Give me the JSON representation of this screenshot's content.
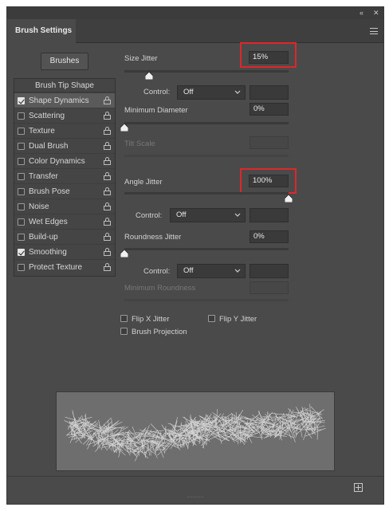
{
  "window": {
    "collapse_glyph": "«",
    "close_glyph": "✕",
    "tab_label": "Brush Settings"
  },
  "brushes_button": "Brushes",
  "sidebar": {
    "header": "Brush Tip Shape",
    "items": [
      {
        "label": "Shape Dynamics",
        "checked": true,
        "selected": true
      },
      {
        "label": "Scattering",
        "checked": false
      },
      {
        "label": "Texture",
        "checked": false
      },
      {
        "label": "Dual Brush",
        "checked": false
      },
      {
        "label": "Color Dynamics",
        "checked": false
      },
      {
        "label": "Transfer",
        "checked": false
      },
      {
        "label": "Brush Pose",
        "checked": false
      },
      {
        "label": "Noise",
        "checked": false
      },
      {
        "label": "Wet Edges",
        "checked": false
      },
      {
        "label": "Build-up",
        "checked": false
      },
      {
        "label": "Smoothing",
        "checked": true
      },
      {
        "label": "Protect Texture",
        "checked": false
      }
    ]
  },
  "settings": {
    "size_jitter": {
      "label": "Size Jitter",
      "value": "15%",
      "slider_fraction": 0.15
    },
    "size_control": {
      "label": "Control:",
      "value": "Off",
      "amount": ""
    },
    "min_diameter": {
      "label": "Minimum Diameter",
      "value": "0%",
      "slider_fraction": 0.0
    },
    "tilt_scale": {
      "label": "Tilt Scale",
      "value": ""
    },
    "angle_jitter": {
      "label": "Angle Jitter",
      "value": "100%",
      "slider_fraction": 1.0
    },
    "angle_control": {
      "label": "Control:",
      "value": "Off",
      "amount": ""
    },
    "roundness_jitter": {
      "label": "Roundness Jitter",
      "value": "0%",
      "slider_fraction": 0.0
    },
    "roundness_control": {
      "label": "Control:",
      "value": "Off",
      "amount": ""
    },
    "min_roundness": {
      "label": "Minimum Roundness",
      "value": ""
    },
    "flip_x": {
      "label": "Flip X Jitter",
      "checked": false
    },
    "flip_y": {
      "label": "Flip Y Jitter",
      "checked": false
    },
    "brush_projection": {
      "label": "Brush Projection",
      "checked": false
    }
  },
  "colors": {
    "panel_bg": "#4a4a4a",
    "highlight_box": "#e0262a"
  },
  "icons": {
    "lock": "lock-icon",
    "new": "new-preset-icon",
    "menu": "panel-menu-icon"
  }
}
